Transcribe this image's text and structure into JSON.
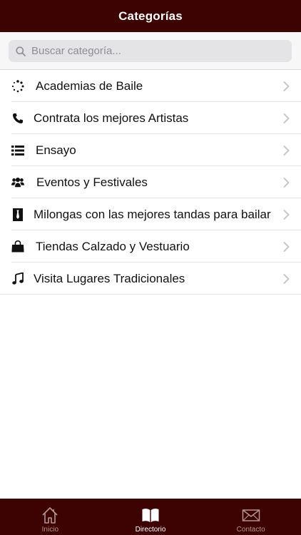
{
  "header": {
    "title": "Categorías"
  },
  "search": {
    "placeholder": "Buscar categoría..."
  },
  "categories": [
    {
      "label": "Academias de Baile",
      "icon": "spinner-icon"
    },
    {
      "label": "Contrata los mejores Artistas",
      "icon": "phone-icon"
    },
    {
      "label": "Ensayo",
      "icon": "list-icon"
    },
    {
      "label": "Eventos y Festivales",
      "icon": "users-icon"
    },
    {
      "label": "Milongas con las mejores tandas para bailar",
      "icon": "tie-icon"
    },
    {
      "label": "Tiendas Calzado y Vestuario",
      "icon": "shopping-bag-icon"
    },
    {
      "label": "Visita Lugares Tradicionales",
      "icon": "music-note-icon"
    }
  ],
  "tabbar": {
    "tabs": [
      {
        "label": "Inicio",
        "icon": "home-icon",
        "active": false
      },
      {
        "label": "Directorio",
        "icon": "book-icon",
        "active": true
      },
      {
        "label": "Contacto",
        "icon": "envelope-icon",
        "active": false
      }
    ]
  },
  "colors": {
    "brand": "#3d0202",
    "tab_active": "#ffffff",
    "tab_inactive": "#b39494"
  }
}
